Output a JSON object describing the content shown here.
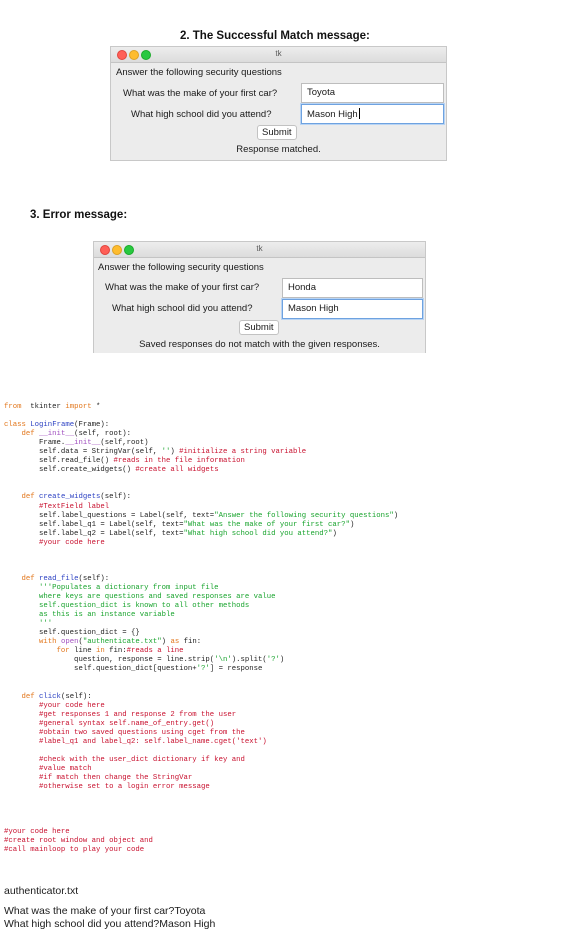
{
  "heading_success": "2. The Successful Match message:",
  "heading_error": "3. Error message:",
  "window_success": {
    "title": "tk",
    "instructions": "Answer the following security questions",
    "q1_label": "What was the make of your first car?",
    "q1_value": "Toyota",
    "q2_label": "What high school did you attend?",
    "q2_value": "Mason High",
    "submit_label": "Submit",
    "status": "Response matched."
  },
  "window_error": {
    "title": "tk",
    "instructions": "Answer the following security questions",
    "q1_label": "What was the make of your first car?",
    "q1_value": "Honda",
    "q2_label": "What high school did you attend?",
    "q2_value": "Mason High",
    "submit_label": "Submit",
    "status": "Saved responses do not match with the given responses."
  },
  "code_lines": [
    [
      [
        "kw",
        "from"
      ],
      [
        "",
        "  tkinter "
      ],
      [
        "kw",
        "import"
      ],
      [
        "",
        " *"
      ]
    ],
    [],
    [
      [
        "kw",
        "class"
      ],
      [
        "",
        " "
      ],
      [
        "fn",
        "LoginFrame"
      ],
      [
        "",
        "(Frame):"
      ]
    ],
    [
      [
        "",
        "    "
      ],
      [
        "kw",
        "def"
      ],
      [
        "",
        " "
      ],
      [
        "bi",
        "__init__"
      ],
      [
        "",
        "(self, root):"
      ]
    ],
    [
      [
        "",
        "        Frame."
      ],
      [
        "bi",
        "__init__"
      ],
      [
        "",
        "(self,root)"
      ]
    ],
    [
      [
        "",
        "        self.data = StringVar(self, "
      ],
      [
        "st",
        "''"
      ],
      [
        "",
        ") "
      ],
      [
        "cm",
        "#initialize a string variable"
      ]
    ],
    [
      [
        "",
        "        self.read_file() "
      ],
      [
        "cm",
        "#reads in the file information"
      ]
    ],
    [
      [
        "",
        "        self.create_widgets() "
      ],
      [
        "cm",
        "#create all widgets"
      ]
    ],
    [],
    [],
    [
      [
        "",
        "    "
      ],
      [
        "kw",
        "def"
      ],
      [
        "",
        " "
      ],
      [
        "fn",
        "create_widgets"
      ],
      [
        "",
        "(self):"
      ]
    ],
    [
      [
        "",
        "        "
      ],
      [
        "cm",
        "#TextField label"
      ]
    ],
    [
      [
        "",
        "        self.label_questions = Label(self, text="
      ],
      [
        "st",
        "\"Answer the following security questions\""
      ],
      [
        "",
        ")"
      ]
    ],
    [
      [
        "",
        "        self.label_q1 = Label(self, text="
      ],
      [
        "st",
        "\"What was the make of your first car?\""
      ],
      [
        "",
        ")"
      ]
    ],
    [
      [
        "",
        "        self.label_q2 = Label(self, text="
      ],
      [
        "st",
        "\"What high school did you attend?\""
      ],
      [
        "",
        ")"
      ]
    ],
    [
      [
        "",
        "        "
      ],
      [
        "cm",
        "#your code here"
      ]
    ],
    [],
    [],
    [],
    [
      [
        "",
        "    "
      ],
      [
        "kw",
        "def"
      ],
      [
        "",
        " "
      ],
      [
        "fn",
        "read_file"
      ],
      [
        "",
        "(self):"
      ]
    ],
    [
      [
        "",
        "        "
      ],
      [
        "st",
        "'''Populates a dictionary from input file"
      ]
    ],
    [
      [
        "st",
        "        where keys are questions and saved responses are value"
      ]
    ],
    [
      [
        "st",
        "        self.question_dict is known to all other methods"
      ]
    ],
    [
      [
        "st",
        "        as this is an instance variable"
      ]
    ],
    [
      [
        "st",
        "        '''"
      ]
    ],
    [
      [
        "",
        "        self.question_dict = {}"
      ]
    ],
    [
      [
        "",
        "        "
      ],
      [
        "kw",
        "with"
      ],
      [
        "",
        " "
      ],
      [
        "bi",
        "open"
      ],
      [
        "",
        "("
      ],
      [
        "st",
        "\"authenticate.txt\""
      ],
      [
        "",
        ") "
      ],
      [
        "kw",
        "as"
      ],
      [
        "",
        " fin:"
      ]
    ],
    [
      [
        "",
        "            "
      ],
      [
        "kw",
        "for"
      ],
      [
        "",
        " line "
      ],
      [
        "kw",
        "in"
      ],
      [
        "",
        " fin:"
      ],
      [
        "cm",
        "#reads a line"
      ]
    ],
    [
      [
        "",
        "                question, response = line.strip("
      ],
      [
        "st",
        "'\\n'"
      ],
      [
        "",
        ").split("
      ],
      [
        "st",
        "'?'"
      ],
      [
        "",
        ")"
      ]
    ],
    [
      [
        "",
        "                self.question_dict[question+"
      ],
      [
        "st",
        "'?'"
      ],
      [
        "",
        "] = response"
      ]
    ],
    [],
    [],
    [
      [
        "",
        "    "
      ],
      [
        "kw",
        "def"
      ],
      [
        "",
        " "
      ],
      [
        "fn",
        "click"
      ],
      [
        "",
        "(self):"
      ]
    ],
    [
      [
        "",
        "        "
      ],
      [
        "cm",
        "#your code here"
      ]
    ],
    [
      [
        "",
        "        "
      ],
      [
        "cm",
        "#get responses 1 and response 2 from the user"
      ]
    ],
    [
      [
        "",
        "        "
      ],
      [
        "cm",
        "#general syntax self.name_of_entry.get()"
      ]
    ],
    [
      [
        "",
        "        "
      ],
      [
        "cm",
        "#obtain two saved questions using cget from the"
      ]
    ],
    [
      [
        "",
        "        "
      ],
      [
        "cm",
        "#label_q1 and label_q2: self.label_name.cget('text')"
      ]
    ],
    [],
    [
      [
        "",
        "        "
      ],
      [
        "cm",
        "#check with the user_dict dictionary if key and"
      ]
    ],
    [
      [
        "",
        "        "
      ],
      [
        "cm",
        "#value match"
      ]
    ],
    [
      [
        "",
        "        "
      ],
      [
        "cm",
        "#if match then change the StringVar"
      ]
    ],
    [
      [
        "",
        "        "
      ],
      [
        "cm",
        "#otherwise set to a login error message"
      ]
    ],
    [],
    [],
    [],
    [],
    [
      [
        "cm",
        "#your code here"
      ]
    ],
    [
      [
        "cm",
        "#create root window and object and"
      ]
    ],
    [
      [
        "cm",
        "#call mainloop to play your code"
      ]
    ]
  ],
  "file_name": "authenticator.txt",
  "file_lines": [
    "What was the make of your first car?Toyota",
    "What high school did you attend?Mason High"
  ]
}
